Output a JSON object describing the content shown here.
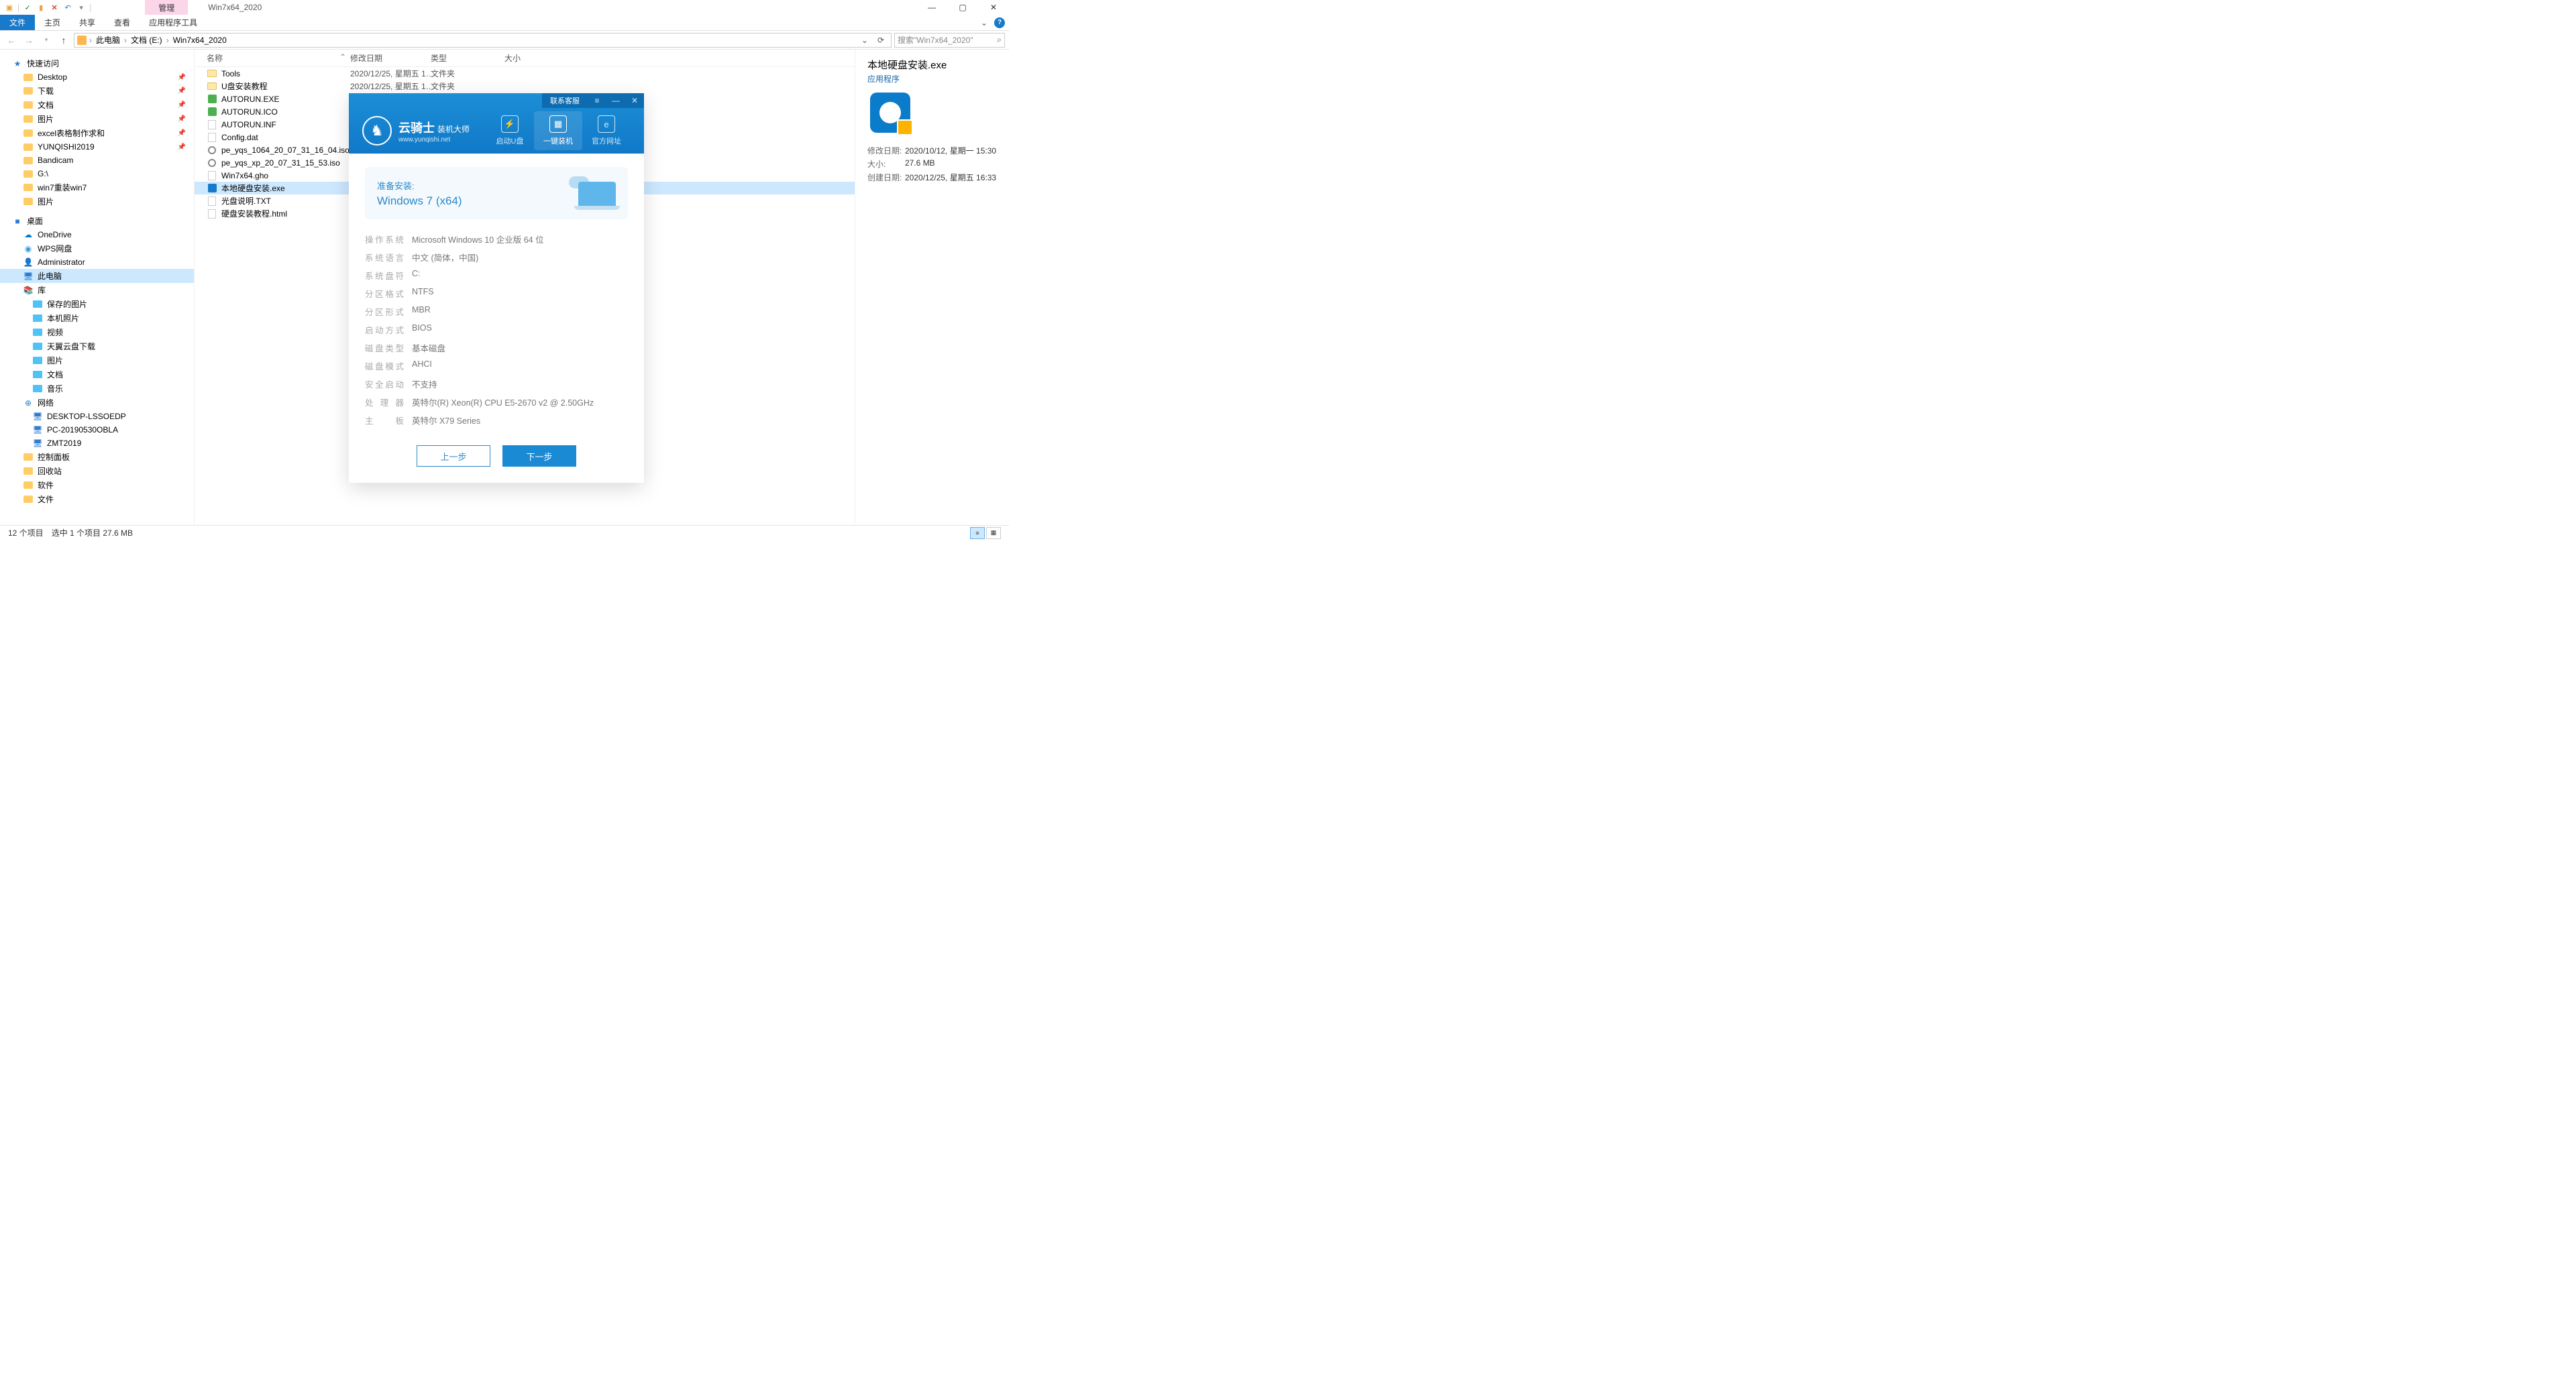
{
  "titlebar": {
    "context_tab": "管理",
    "window_title": "Win7x64_2020"
  },
  "ribbon": {
    "file": "文件",
    "tabs": [
      "主页",
      "共享",
      "查看",
      "应用程序工具"
    ]
  },
  "breadcrumb": {
    "items": [
      "此电脑",
      "文档 (E:)",
      "Win7x64_2020"
    ]
  },
  "search": {
    "placeholder": "搜索\"Win7x64_2020\""
  },
  "nav": {
    "quick": {
      "label": "快速访问",
      "items": [
        {
          "label": "Desktop",
          "pin": true
        },
        {
          "label": "下载",
          "pin": true
        },
        {
          "label": "文档",
          "pin": true
        },
        {
          "label": "图片",
          "pin": true
        },
        {
          "label": "excel表格制作求和",
          "pin": true
        },
        {
          "label": "YUNQISHI2019",
          "pin": true
        },
        {
          "label": "Bandicam",
          "pin": false
        },
        {
          "label": "G:\\",
          "pin": false
        },
        {
          "label": "win7重装win7",
          "pin": false
        },
        {
          "label": "图片",
          "pin": false
        }
      ]
    },
    "desktop": {
      "label": "桌面",
      "items": [
        {
          "label": "OneDrive",
          "ico": "onedrive"
        },
        {
          "label": "WPS网盘",
          "ico": "wps"
        },
        {
          "label": "Administrator",
          "ico": "user"
        },
        {
          "label": "此电脑",
          "ico": "pc",
          "selected": true
        },
        {
          "label": "库",
          "ico": "lib"
        }
      ]
    },
    "lib_items": [
      {
        "label": "保存的图片"
      },
      {
        "label": "本机照片"
      },
      {
        "label": "视频"
      },
      {
        "label": "天翼云盘下载"
      },
      {
        "label": "图片"
      },
      {
        "label": "文档"
      },
      {
        "label": "音乐"
      }
    ],
    "network": {
      "label": "网络",
      "items": [
        {
          "label": "DESKTOP-LSSOEDP"
        },
        {
          "label": "PC-20190530OBLA"
        },
        {
          "label": "ZMT2019"
        }
      ]
    },
    "extras": [
      {
        "label": "控制面板"
      },
      {
        "label": "回收站"
      },
      {
        "label": "软件"
      },
      {
        "label": "文件"
      }
    ]
  },
  "columns": {
    "name": "名称",
    "date": "修改日期",
    "type": "类型",
    "size": "大小"
  },
  "files": [
    {
      "name": "Tools",
      "date": "2020/12/25, 星期五 1…",
      "type": "文件夹",
      "ico": "fld"
    },
    {
      "name": "U盘安装教程",
      "date": "2020/12/25, 星期五 1…",
      "type": "文件夹",
      "ico": "fld"
    },
    {
      "name": "AUTORUN.EXE",
      "date": "",
      "type": "",
      "ico": "exe-g"
    },
    {
      "name": "AUTORUN.ICO",
      "date": "",
      "type": "",
      "ico": "exe-g"
    },
    {
      "name": "AUTORUN.INF",
      "date": "",
      "type": "",
      "ico": "cfg"
    },
    {
      "name": "Config.dat",
      "date": "",
      "type": "",
      "ico": "white"
    },
    {
      "name": "pe_yqs_1064_20_07_31_16_04.iso",
      "date": "",
      "type": "",
      "ico": "disc"
    },
    {
      "name": "pe_yqs_xp_20_07_31_15_53.iso",
      "date": "",
      "type": "",
      "ico": "disc"
    },
    {
      "name": "Win7x64.gho",
      "date": "",
      "type": "",
      "ico": "white"
    },
    {
      "name": "本地硬盘安装.exe",
      "date": "",
      "type": "",
      "ico": "exe-b",
      "selected": true
    },
    {
      "name": "光盘说明.TXT",
      "date": "",
      "type": "",
      "ico": "txt"
    },
    {
      "name": "硬盘安装教程.html",
      "date": "",
      "type": "",
      "ico": "white"
    }
  ],
  "details": {
    "title": "本地硬盘安装.exe",
    "type": "应用程序",
    "rows": [
      {
        "k": "修改日期:",
        "v": "2020/10/12, 星期一 15:30"
      },
      {
        "k": "大小:",
        "v": "27.6 MB"
      },
      {
        "k": "创建日期:",
        "v": "2020/12/25, 星期五 16:33"
      }
    ]
  },
  "status": {
    "count": "12 个项目",
    "sel": "选中 1 个项目  27.6 MB"
  },
  "installer": {
    "top_link": "联系客服",
    "brand_cn": "云骑士",
    "brand_sub": "装机大师",
    "brand_url": "www.yunqishi.net",
    "tabs": [
      {
        "label": "启动U盘",
        "glyph": "⚡"
      },
      {
        "label": "一键装机",
        "glyph": "▦",
        "active": true
      },
      {
        "label": "官方网址",
        "glyph": "e"
      }
    ],
    "banner_t1": "准备安装:",
    "banner_t2": "Windows 7 (x64)",
    "sys": [
      {
        "k": "操作系统",
        "v": "Microsoft Windows 10 企业版 64 位"
      },
      {
        "k": "系统语言",
        "v": "中文 (简体，中国)"
      },
      {
        "k": "系统盘符",
        "v": "C:"
      },
      {
        "k": "分区格式",
        "v": "NTFS"
      },
      {
        "k": "分区形式",
        "v": "MBR"
      },
      {
        "k": "启动方式",
        "v": "BIOS"
      },
      {
        "k": "磁盘类型",
        "v": "基本磁盘"
      },
      {
        "k": "磁盘模式",
        "v": "AHCI"
      },
      {
        "k": "安全启动",
        "v": "不支持"
      },
      {
        "k": "处理器",
        "v": "英特尔(R) Xeon(R) CPU E5-2670 v2 @ 2.50GHz"
      },
      {
        "k": "主板",
        "v": "英特尔 X79 Series"
      }
    ],
    "btn_prev": "上一步",
    "btn_next": "下一步"
  }
}
